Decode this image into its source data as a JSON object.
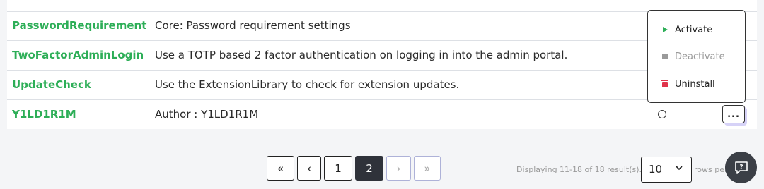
{
  "extensions": {
    "rows": [
      {
        "name": "PasswordRequirement",
        "description": "Core: Password requirement settings"
      },
      {
        "name": "TwoFactorAdminLogin",
        "description": "Use a TOTP based 2 factor authentication on logging in into the admin portal."
      },
      {
        "name": "UpdateCheck",
        "description": "Use the ExtensionLibrary to check for extension updates."
      },
      {
        "name": "Y1LD1R1M",
        "description": "Author : Y1LD1R1M",
        "menu_label": "..."
      }
    ]
  },
  "dropdown": {
    "items": [
      {
        "label": "Activate",
        "icon": "play-icon",
        "color": "#2dae57",
        "enabled": true
      },
      {
        "label": "Deactivate",
        "icon": "stop-icon",
        "color": "#9a9a9a",
        "enabled": false
      },
      {
        "label": "Uninstall",
        "icon": "trash-icon",
        "color": "#e0334b",
        "enabled": true
      }
    ]
  },
  "pagination": {
    "first": "«",
    "prev": "‹",
    "pages": [
      "1",
      "2"
    ],
    "current_page": "2",
    "next": "›",
    "last": "»",
    "displaying_text": "Displaying 11-18 of 18 result(s).",
    "rows_per_page_value": "10",
    "rows_per_page_label": "rows per page"
  },
  "feedback": {
    "icon": "help-chat-icon"
  },
  "colors": {
    "accent_green": "#2dae57",
    "active_page": "#2f323a",
    "danger": "#e0334b"
  }
}
